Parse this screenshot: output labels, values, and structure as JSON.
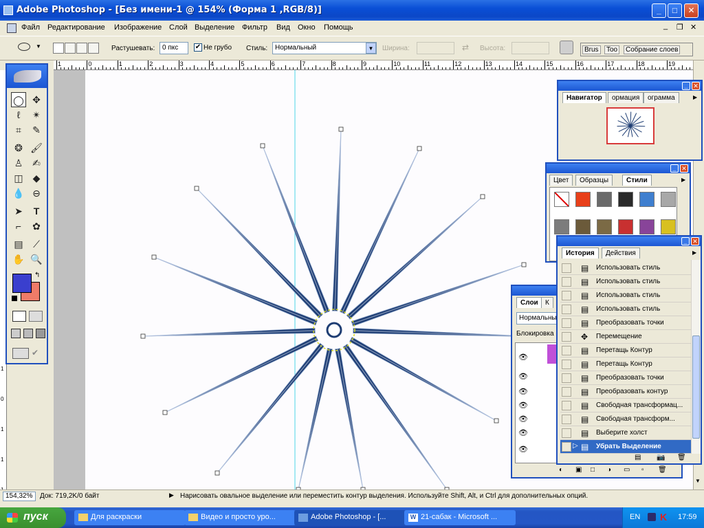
{
  "window": {
    "title": "Adobe Photoshop - [Без имени-1 @ 154% (Форма 1 ,RGB/8)]",
    "min_label": "_",
    "max_label": "□",
    "close_label": "✕",
    "doc_min": "_",
    "doc_restore": "❐",
    "doc_close": "✕"
  },
  "menu": [
    "Файл",
    "Редактирование",
    "Изображение",
    "Слой",
    "Выделение",
    "Фильтр",
    "Вид",
    "Окно",
    "Помощь"
  ],
  "options": {
    "feather_label": "Растушевать:",
    "feather_value": "0 пкс",
    "antialias_label": "Не грубо",
    "style_label": "Стиль:",
    "style_value": "Нормальный",
    "width_label": "Ширина:",
    "height_label": "Высота:",
    "well_tabs": [
      "Brus",
      "Too",
      "Собрание слоев"
    ]
  },
  "ruler": {
    "ticks": [
      "1",
      "0",
      "1",
      "2",
      "3",
      "4",
      "5",
      "6",
      "7",
      "8",
      "9",
      "10",
      "11",
      "12",
      "13",
      "14",
      "15",
      "16",
      "17",
      "18",
      "19"
    ],
    "left_ticks": [
      "1",
      "0",
      "1",
      "1",
      "1"
    ]
  },
  "status": {
    "zoom": "154,32%",
    "doc": "Док: 719,2K/0 байт",
    "hint": "Нарисовать овальное выделение или переместить контур выделения. Используйте Shift, Alt, и Ctrl для дополнительных опций."
  },
  "navigator": {
    "tabs": [
      "Навигатор",
      "ормация",
      "ограмма"
    ]
  },
  "color_panel": {
    "tabs": [
      "Цвет",
      "Образцы",
      "Стили"
    ],
    "swatches": [
      "#ffffff",
      "#e8401a",
      "#6a6a6a",
      "#2a2a2a",
      "#3f7fcf",
      "#a8a8a8",
      "#7c7c7c",
      "#6b5a3a",
      "#7b6a45",
      "#c83030",
      "#884499",
      "#d8c020"
    ]
  },
  "history_panel": {
    "tabs": [
      "История",
      "Действия"
    ],
    "items": [
      "Использовать стиль",
      "Использовать стиль",
      "Использовать стиль",
      "Использовать стиль",
      "Преобразовать точки",
      "Перемещение",
      "Перетащь Контур",
      "Перетащь Контур",
      "Преобразовать точки",
      "Преобразовать контур",
      "Свободная трансформац...",
      "Свободная трансформ...",
      "Выберите холст",
      "Убрать Выделение"
    ]
  },
  "layers_panel": {
    "tabs": [
      "Слои",
      "К"
    ],
    "blend": "Нормальны",
    "lock_label": "Блокировка"
  },
  "colors": {
    "foreground": "#3a3fce",
    "background": "#ef7b68",
    "accent": "#1f4fbd",
    "star": "#1e3d73"
  },
  "taskbar": {
    "start": "пуск",
    "tasks": [
      "Для раскраски",
      "Видео и просто уро...",
      "Adobe Photoshop - [...",
      "21-сабак - Microsoft ..."
    ],
    "lang": "EN",
    "clock": "17:59"
  }
}
